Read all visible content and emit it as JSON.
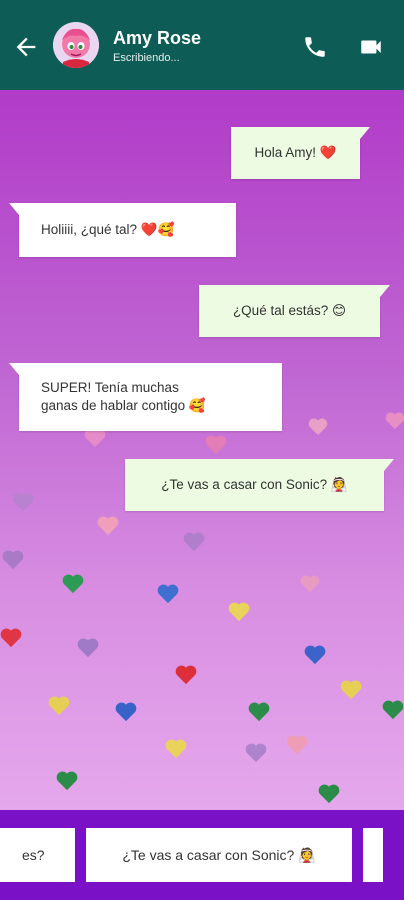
{
  "header": {
    "contact_name": "Amy Rose",
    "status": "Escribiendo...",
    "bg_color": "#0d5c56"
  },
  "messages": [
    {
      "direction": "outgoing",
      "text": "Hola Amy! ❤️"
    },
    {
      "direction": "incoming",
      "text": "Holiiii, ¿qué tal? ❤️🥰"
    },
    {
      "direction": "outgoing",
      "text": "¿Qué tal estás? 😊"
    },
    {
      "direction": "incoming",
      "line1": "SUPER! Tenía muchas",
      "line2": "ganas de hablar contigo 🥰"
    },
    {
      "direction": "outgoing",
      "text": "¿Te vas a casar con Sonic? 👰"
    }
  ],
  "reply_options": [
    {
      "text": "es?"
    },
    {
      "text": "¿Te vas a casar con Sonic? 👰"
    },
    {
      "text": ""
    }
  ],
  "colors": {
    "outgoing_bubble": "#eefbe3",
    "incoming_bubble": "#ffffff",
    "reply_bar": "#7a11c7",
    "background_top": "#b13bc8",
    "background_bottom": "#e5a8ec"
  },
  "icons": [
    "back-arrow-icon",
    "phone-icon",
    "video-call-icon",
    "heart-icon"
  ]
}
